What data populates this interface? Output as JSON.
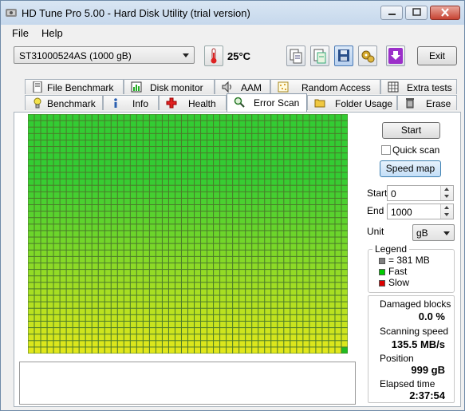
{
  "window": {
    "title": "HD Tune Pro 5.00 - Hard Disk Utility (trial version)"
  },
  "menu": {
    "file": "File",
    "help": "Help"
  },
  "toolbar": {
    "drive": "ST31000524AS (1000 gB)",
    "temperature": "25°C",
    "exit_label": "Exit"
  },
  "tabs_top": [
    {
      "label": "File Benchmark",
      "icon": "file-benchmark-icon"
    },
    {
      "label": "Disk monitor",
      "icon": "disk-monitor-icon"
    },
    {
      "label": "AAM",
      "icon": "speaker-icon"
    },
    {
      "label": "Random Access",
      "icon": "random-access-icon"
    },
    {
      "label": "Extra tests",
      "icon": "extra-tests-icon"
    }
  ],
  "tabs_bottom": [
    {
      "label": "Benchmark",
      "icon": "lightbulb-icon"
    },
    {
      "label": "Info",
      "icon": "info-icon"
    },
    {
      "label": "Health",
      "icon": "health-cross-icon"
    },
    {
      "label": "Error Scan",
      "icon": "magnifier-icon",
      "active": true
    },
    {
      "label": "Folder Usage",
      "icon": "folder-icon"
    },
    {
      "label": "Erase",
      "icon": "trash-icon"
    }
  ],
  "scan": {
    "start_button": "Start",
    "quick_scan_label": "Quick scan",
    "quick_scan_checked": false,
    "speed_map_button": "Speed map",
    "start_label": "Start",
    "start_value": "0",
    "end_label": "End",
    "end_value": "1000",
    "unit_label": "Unit",
    "unit_value": "gB"
  },
  "legend": {
    "title": "Legend",
    "block": "= 381 MB",
    "fast": "Fast",
    "slow": "Slow",
    "colors": {
      "block": "#808080",
      "fast": "#00cc00",
      "slow": "#dd0000"
    }
  },
  "stats": {
    "damaged_label": "Damaged blocks",
    "damaged_value": "0.0 %",
    "speed_label": "Scanning speed",
    "speed_value": "135.5 MB/s",
    "position_label": "Position",
    "position_value": "999 gB",
    "elapsed_label": "Elapsed time",
    "elapsed_value": "2:37:54"
  },
  "scan_map": {
    "columns": 50,
    "rows": 37,
    "scanned_fraction": 1.0,
    "colors": {
      "fast_top": "#33cc33",
      "slow_bottom": "#e8e81a",
      "current": "#22bb22"
    }
  }
}
